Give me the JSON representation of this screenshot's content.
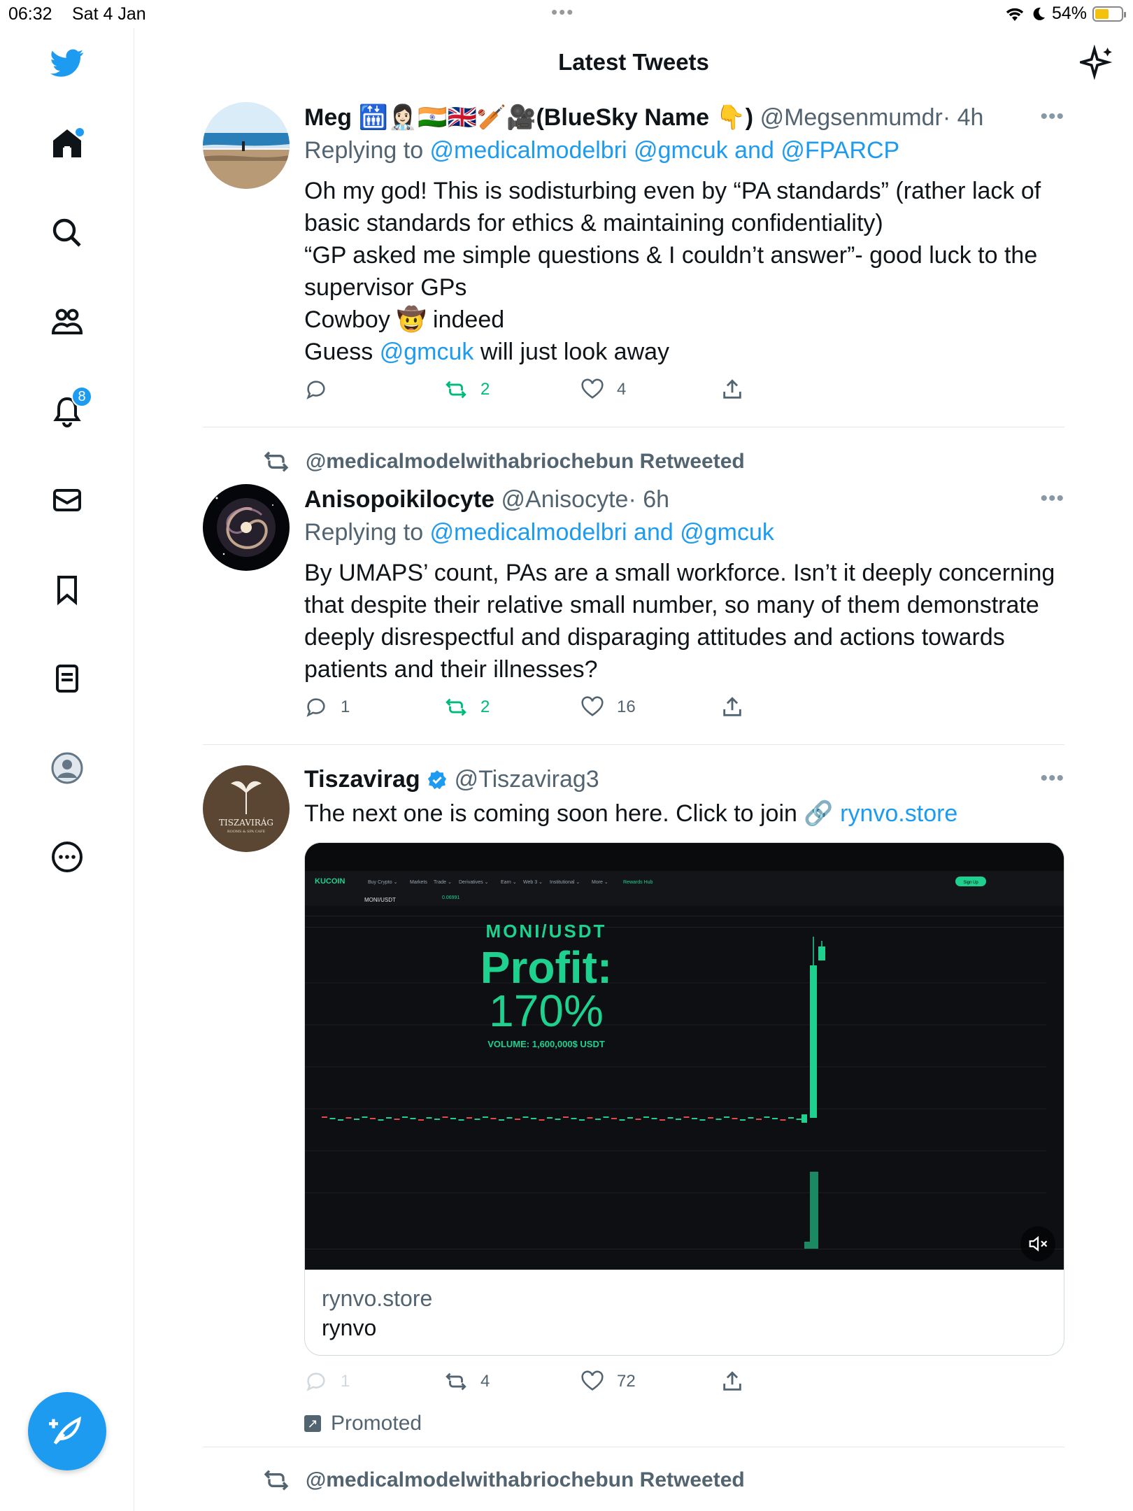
{
  "status": {
    "time": "06:32",
    "date": "Sat 4 Jan",
    "battery": "54%",
    "battery_level": 0.54
  },
  "header": {
    "title": "Latest Tweets"
  },
  "sidebar": {
    "items": [
      {
        "name": "home",
        "icon": "home-icon",
        "dot": true
      },
      {
        "name": "search",
        "icon": "search-icon"
      },
      {
        "name": "communities",
        "icon": "communities-icon"
      },
      {
        "name": "notifications",
        "icon": "bell-icon",
        "badge": "8"
      },
      {
        "name": "messages",
        "icon": "mail-icon"
      },
      {
        "name": "bookmarks",
        "icon": "bookmark-icon"
      },
      {
        "name": "lists",
        "icon": "list-icon"
      },
      {
        "name": "profile",
        "icon": "profile-icon"
      },
      {
        "name": "more",
        "icon": "more-circle-icon"
      }
    ]
  },
  "tweets": [
    {
      "name": "Meg 🛗👩🏻‍⚕️🇮🇳🇬🇧🏏🎥(BlueSky Name 👇)",
      "handle": "@Megsenmumdr",
      "time": "· 4h",
      "replying_prefix": "Replying to ",
      "replying_links": "@medicalmodelbri @gmcuk and @FPARCP",
      "lines": [
        "Oh my god! This is sodisturbing even by “PA standards” (rather lack of",
        "basic standards for ethics & maintaining confidentiality)",
        "“GP asked me simple questions & I couldn’t answer”- good luck to the",
        "supervisor GPs",
        "Cowboy 🤠 indeed"
      ],
      "last_line_prefix": "Guess ",
      "last_line_link": "@gmcuk",
      "last_line_suffix": " will just look away",
      "replies": "",
      "retweets": "2",
      "likes": "4"
    },
    {
      "retweeted_by": "@medicalmodelwithabriochebun Retweeted",
      "name": "Anisopoikilocyte",
      "handle": "@Anisocyte",
      "time": "· 6h",
      "replying_prefix": "Replying to ",
      "replying_links": "@medicalmodelbri and @gmcuk",
      "lines": [
        "By UMAPS’ count, PAs are a small workforce. Isn’t it deeply concerning",
        "that despite their relative small number, so many of them demonstrate",
        "deeply disrespectful and disparaging attitudes and actions towards",
        "patients and their illnesses?"
      ],
      "replies": "1",
      "retweets": "2",
      "likes": "16"
    },
    {
      "name": "Tiszavirag",
      "verified": true,
      "handle": "@Tiszavirag3",
      "text_prefix": "The next one is coming soon here. Click to join 🔗 ",
      "text_link": "rynvo.store",
      "card": {
        "domain": "rynvo.store",
        "title": "rynvo",
        "pair": "MONI/USDT",
        "headline": "Profit:",
        "percent": "170%",
        "volume": "VOLUME: 1,600,000$ USDT",
        "exchange": "KUCOIN",
        "avatar_text": "TISZAVIRÁG",
        "avatar_sub": "ROOMS & SPA CAFE"
      },
      "replies": "1",
      "retweets": "4",
      "likes": "72",
      "promoted": "Promoted"
    }
  ],
  "next": {
    "retweeted_by": "@medicalmodelwithabriochebun Retweeted"
  },
  "colors": {
    "accent": "#1d9bf0",
    "retweet": "#00ba7c",
    "chart_green": "#1fd18f"
  }
}
